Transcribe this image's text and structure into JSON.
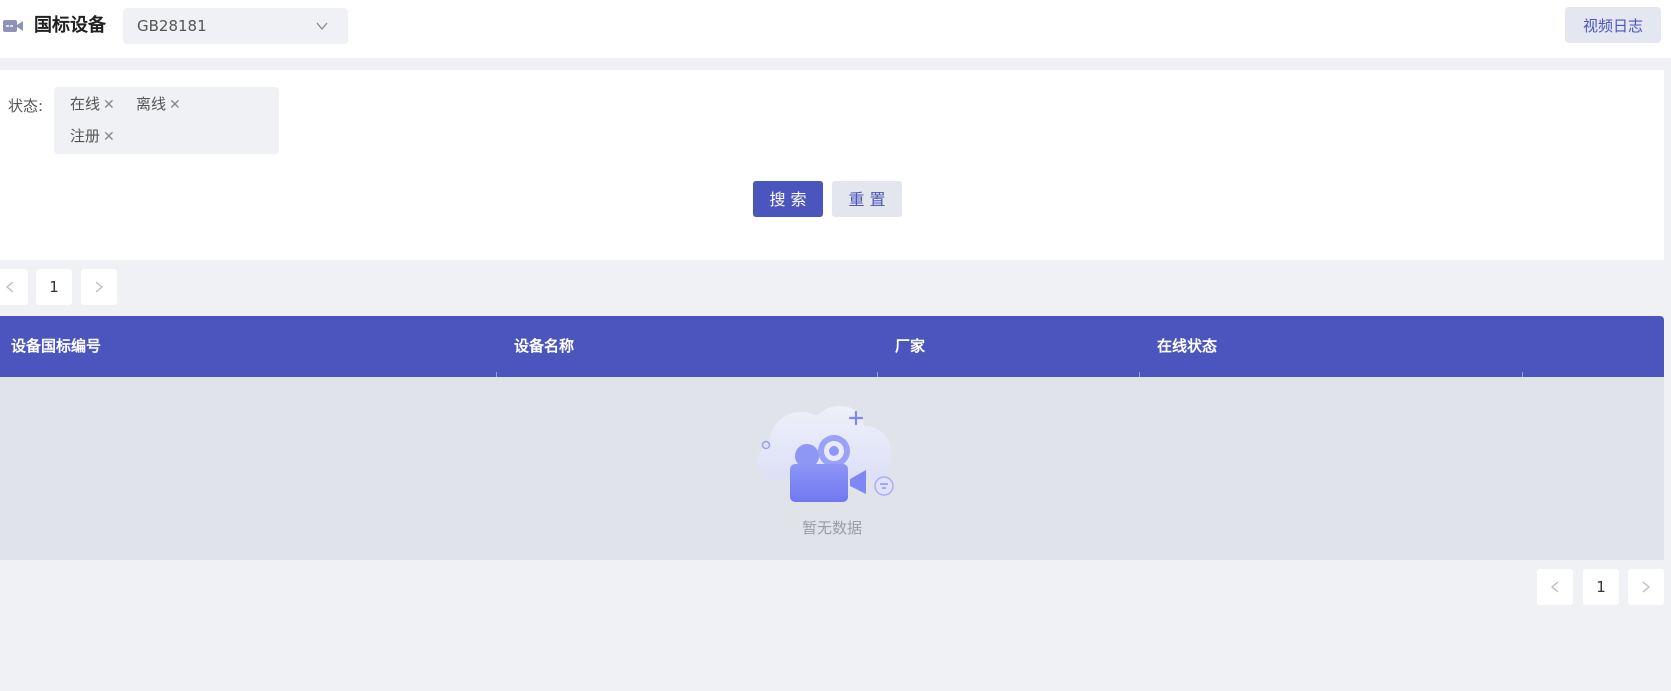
{
  "header": {
    "title": "国标设备",
    "protocol_select": {
      "value": "GB28181"
    },
    "log_button_label": "视频日志",
    "icons": {
      "title_icon": "video-camera-icon",
      "select_arrow": "chevron-down-icon"
    }
  },
  "filter": {
    "status_label": "状态:",
    "tags": [
      {
        "label": "在线"
      },
      {
        "label": "离线"
      },
      {
        "label": "注册"
      }
    ],
    "search_label": "搜索",
    "reset_label": "重置"
  },
  "pagination_top": {
    "current_page": "1",
    "prev_icon": "chevron-left-icon",
    "next_icon": "chevron-right-icon"
  },
  "table": {
    "columns": [
      "设备国标编号",
      "设备名称",
      "厂家",
      "在线状态"
    ],
    "rows": [],
    "empty_text": "暂无数据"
  },
  "pagination_bottom": {
    "current_page": "1",
    "prev_icon": "chevron-left-icon",
    "next_icon": "chevron-right-icon"
  },
  "colors": {
    "accent": "#4a55bd",
    "page_bg": "#f0f1f5",
    "table_body_bg": "#e1e3eb"
  }
}
